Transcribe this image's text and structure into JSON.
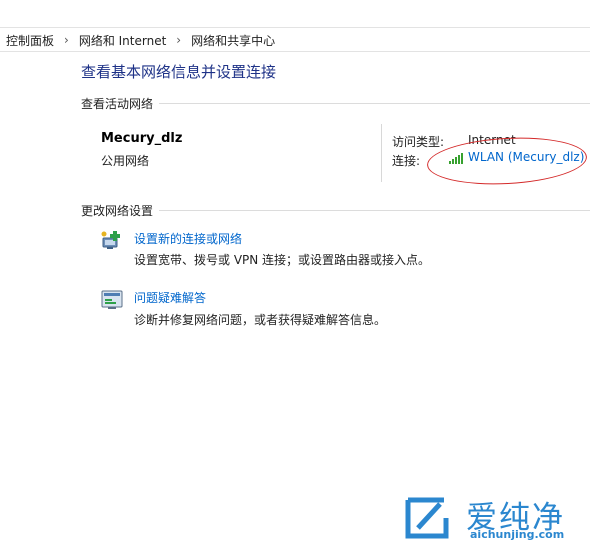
{
  "breadcrumb": {
    "items": [
      "控制面板",
      "网络和 Internet",
      "网络和共享中心"
    ],
    "separator": "›"
  },
  "main": {
    "title": "查看基本网络信息并设置连接",
    "active_networks": {
      "heading": "查看活动网络",
      "network_name": "Mecury_dlz",
      "network_type": "公用网络",
      "access_type_label": "访问类型:",
      "access_type_value": "Internet",
      "connections_label": "连接:",
      "connection_link": "WLAN (Mecury_dlz)",
      "connection_icon": "wifi-signal-icon"
    },
    "change_settings": {
      "heading": "更改网络设置",
      "tasks": [
        {
          "link": "设置新的连接或网络",
          "description": "设置宽带、拨号或 VPN 连接；或设置路由器或接入点。",
          "icon": "new-connection-icon"
        },
        {
          "link": "问题疑难解答",
          "description": "诊断并修复网络问题，或者获得疑难解答信息。",
          "icon": "troubleshoot-icon"
        }
      ]
    }
  },
  "annotation": {
    "color": "#d42a2a"
  },
  "watermark": {
    "text": "爱纯净",
    "url": "aichunjing.com",
    "color": "#2b87cf"
  },
  "colors": {
    "title": "#1e3287",
    "link": "#0066cc"
  }
}
